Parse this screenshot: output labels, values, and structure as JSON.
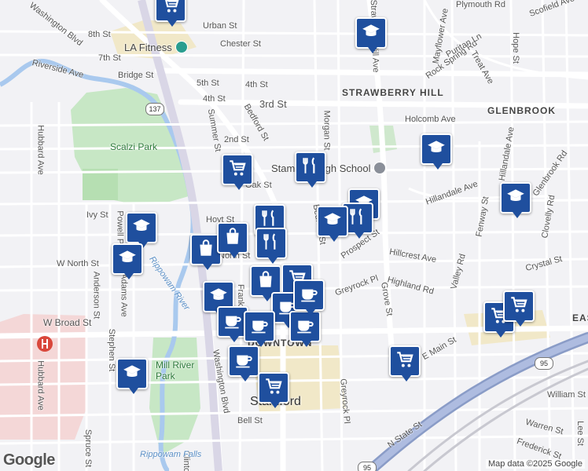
{
  "map": {
    "attribution": "Map data ©2025 Google",
    "logo": "Google",
    "streets": [
      "Washington Blvd",
      "Urban St",
      "8th St",
      "7th St",
      "Chester St",
      "Bridge St",
      "Riverside Ave",
      "5th St",
      "4th St",
      "4th St",
      "3rd St",
      "2nd St",
      "Summer St",
      "Bedford St",
      "Morgan St",
      "Holcomb Ave",
      "Strawberry Hill Ave",
      "Mayflower Ave",
      "Rock Spring Rd",
      "Puritan Ln",
      "Treat Ave",
      "Plymouth Rd",
      "Scofield Ave",
      "Hope St",
      "Hubbard Ave",
      "Oak St",
      "Ivy St",
      "Hoyt St",
      "Powell Pl",
      "W North St",
      "North St",
      "Anderson St",
      "Adams Ave",
      "W Broad St",
      "Stephen St",
      "Hubbard Ave",
      "Frank",
      "Grove St",
      "Bedford St",
      "Prospect St",
      "Hillandale Ave",
      "Hillandale Ave",
      "Fenway St",
      "Valley Rd",
      "Hillcrest Ave",
      "Highland Rd",
      "Crystal St",
      "Greyrock Pl",
      "Greyrock Pl",
      "Clovelly Rd",
      "Glenbrook Rd",
      "E Main St",
      "Washington Blvd",
      "Bell St",
      "N State St",
      "William St",
      "Warren St",
      "Lee St",
      "Frederick St",
      "Spruce St",
      "Clinton"
    ],
    "areas": [
      "STRAWBERRY HILL",
      "GLENBROOK",
      "DOWNTOWN",
      "EAS"
    ],
    "parks": [
      "Scalzi Park",
      "Mill River Park"
    ],
    "river": [
      "Rippowam River",
      "Rippowam Falls"
    ],
    "city": "Stamford",
    "highways": [
      "137",
      "95",
      "95"
    ],
    "places": [
      {
        "name": "LA Fitness",
        "icon": "fitness-icon"
      },
      {
        "name": "Stamford High School",
        "icon": "school-icon"
      }
    ],
    "markers": [
      {
        "kind": "shopping-cart"
      },
      {
        "kind": "school"
      },
      {
        "kind": "shopping-cart"
      },
      {
        "kind": "restaurant"
      },
      {
        "kind": "school"
      },
      {
        "kind": "school"
      },
      {
        "kind": "restaurant"
      },
      {
        "kind": "restaurant"
      },
      {
        "kind": "school"
      },
      {
        "kind": "shopping-bag"
      },
      {
        "kind": "shopping-bag"
      },
      {
        "kind": "restaurant"
      },
      {
        "kind": "school"
      },
      {
        "kind": "school"
      },
      {
        "kind": "school"
      },
      {
        "kind": "shopping-bag"
      },
      {
        "kind": "shopping-cart"
      },
      {
        "kind": "coffee"
      },
      {
        "kind": "coffee"
      },
      {
        "kind": "coffee"
      },
      {
        "kind": "coffee"
      },
      {
        "kind": "coffee"
      },
      {
        "kind": "shopping-cart"
      },
      {
        "kind": "school"
      },
      {
        "kind": "shopping-cart"
      },
      {
        "kind": "shopping-cart"
      },
      {
        "kind": "shopping-cart"
      },
      {
        "kind": "school"
      },
      {
        "kind": "coffee"
      }
    ]
  }
}
